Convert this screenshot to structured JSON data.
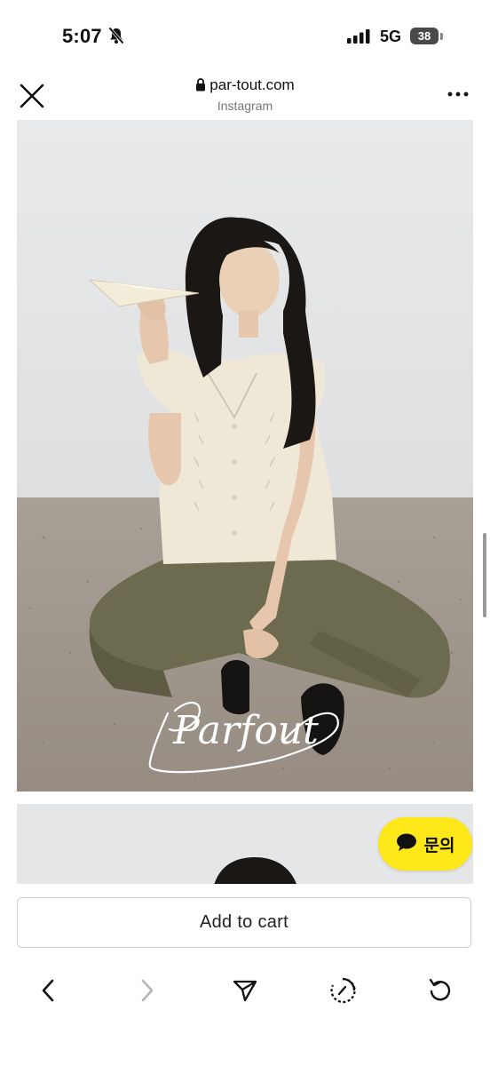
{
  "status_bar": {
    "time": "5:07",
    "network": "5G",
    "battery": "38"
  },
  "browser": {
    "url": "par-tout.com",
    "subtitle": "Instagram"
  },
  "content": {
    "photo1_alt": "Parfout model photo",
    "logo_text": "Parfout"
  },
  "chat_button": {
    "label": "문의"
  },
  "cart": {
    "label": "Add to cart"
  },
  "toolbar": {
    "items": [
      "back",
      "forward",
      "share",
      "history",
      "reload"
    ]
  },
  "colors": {
    "chat_yellow": "#ffe81a",
    "floor": "#a49a90",
    "wall": "#e3e4e6"
  }
}
